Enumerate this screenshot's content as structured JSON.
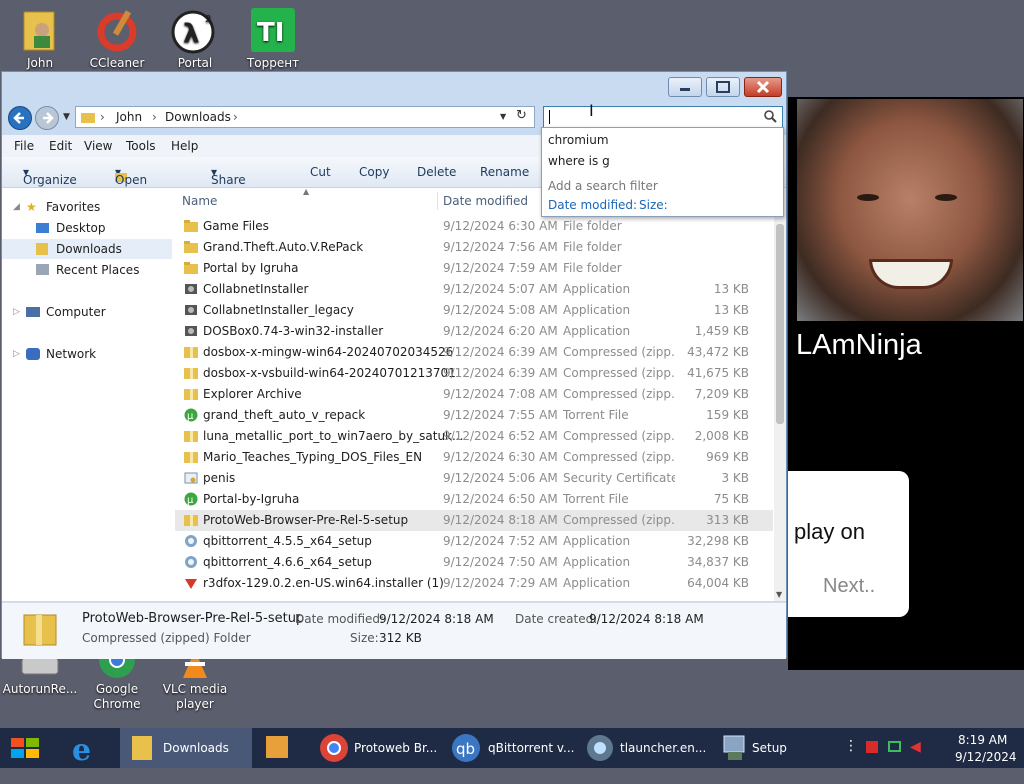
{
  "desktop": {
    "icons_top": [
      {
        "label": "John"
      },
      {
        "label": "CCleaner"
      },
      {
        "label": "Portal"
      },
      {
        "label": "Торрент"
      }
    ],
    "icons_bottom": [
      {
        "label": "AutorunRe..."
      },
      {
        "label": "Google Chrome"
      },
      {
        "label": "VLC media player"
      }
    ]
  },
  "video": {
    "streamer_name": "LAmNinja",
    "chat_text": "play on",
    "next_label": "Next.."
  },
  "window": {
    "address": {
      "crumbs": [
        "John",
        "Downloads"
      ]
    },
    "search": {
      "value": "",
      "suggestions": [
        "chromium",
        "where is g"
      ],
      "filter_hint": "Add a search filter",
      "filters": [
        "Date modified:",
        "Size:"
      ]
    },
    "menu": [
      "File",
      "Edit",
      "View",
      "Tools",
      "Help"
    ],
    "toolbar": [
      "Organize",
      "Open",
      "Share with",
      "Cut",
      "Copy",
      "Delete",
      "Rename"
    ],
    "navpane": {
      "favorites": "Favorites",
      "items": [
        "Desktop",
        "Downloads",
        "Recent Places"
      ],
      "computer": "Computer",
      "network": "Network"
    },
    "columns": {
      "name": "Name",
      "date": "Date modified"
    },
    "files": [
      {
        "name": "Game Files",
        "date": "9/12/2024 6:30 AM",
        "type": "File folder",
        "size": "",
        "icon": "folder"
      },
      {
        "name": "Grand.Theft.Auto.V.RePack",
        "date": "9/12/2024 7:56 AM",
        "type": "File folder",
        "size": "",
        "icon": "folder"
      },
      {
        "name": "Portal by Igruha",
        "date": "9/12/2024 7:59 AM",
        "type": "File folder",
        "size": "",
        "icon": "folder"
      },
      {
        "name": "CollabnetInstaller",
        "date": "9/12/2024 5:07 AM",
        "type": "Application",
        "size": "13 KB",
        "icon": "installer"
      },
      {
        "name": "CollabnetInstaller_legacy",
        "date": "9/12/2024 5:08 AM",
        "type": "Application",
        "size": "13 KB",
        "icon": "installer"
      },
      {
        "name": "DOSBox0.74-3-win32-installer",
        "date": "9/12/2024 6:20 AM",
        "type": "Application",
        "size": "1,459 KB",
        "icon": "installer"
      },
      {
        "name": "dosbox-x-mingw-win64-20240702034526",
        "date": "9/12/2024 6:39 AM",
        "type": "Compressed (zipp...",
        "size": "43,472 KB",
        "icon": "zip"
      },
      {
        "name": "dosbox-x-vsbuild-win64-20240701213701",
        "date": "9/12/2024 6:39 AM",
        "type": "Compressed (zipp...",
        "size": "41,675 KB",
        "icon": "zip"
      },
      {
        "name": "Explorer Archive",
        "date": "9/12/2024 7:08 AM",
        "type": "Compressed (zipp...",
        "size": "7,209 KB",
        "icon": "zip"
      },
      {
        "name": "grand_theft_auto_v_repack",
        "date": "9/12/2024 7:55 AM",
        "type": "Torrent File",
        "size": "159 KB",
        "icon": "torrent"
      },
      {
        "name": "luna_metallic_port_to_win7aero_by_satuk...",
        "date": "9/12/2024 6:52 AM",
        "type": "Compressed (zipp...",
        "size": "2,008 KB",
        "icon": "zip"
      },
      {
        "name": "Mario_Teaches_Typing_DOS_Files_EN",
        "date": "9/12/2024 6:30 AM",
        "type": "Compressed (zipp...",
        "size": "969 KB",
        "icon": "zip"
      },
      {
        "name": "penis",
        "date": "9/12/2024 5:06 AM",
        "type": "Security Certificate",
        "size": "3 KB",
        "icon": "cert"
      },
      {
        "name": "Portal-by-Igruha",
        "date": "9/12/2024 6:50 AM",
        "type": "Torrent File",
        "size": "75 KB",
        "icon": "torrent"
      },
      {
        "name": "ProtoWeb-Browser-Pre-Rel-5-setup",
        "date": "9/12/2024 8:18 AM",
        "type": "Compressed (zipp...",
        "size": "313 KB",
        "icon": "zip",
        "selected": true
      },
      {
        "name": "qbittorrent_4.5.5_x64_setup",
        "date": "9/12/2024 7:52 AM",
        "type": "Application",
        "size": "32,298 KB",
        "icon": "qbit"
      },
      {
        "name": "qbittorrent_4.6.6_x64_setup",
        "date": "9/12/2024 7:50 AM",
        "type": "Application",
        "size": "34,837 KB",
        "icon": "qbit"
      },
      {
        "name": "r3dfox-129.0.2.en-US.win64.installer (1)",
        "date": "9/12/2024 7:29 AM",
        "type": "Application",
        "size": "64,004 KB",
        "icon": "fox"
      }
    ],
    "details": {
      "name": "ProtoWeb-Browser-Pre-Rel-5-setup",
      "type": "Compressed (zipped) Folder",
      "date_modified_label": "Date modified:",
      "date_modified": "9/12/2024 8:18 AM",
      "date_created_label": "Date created:",
      "date_created": "9/12/2024 8:18 AM",
      "size_label": "Size:",
      "size": "312 KB"
    }
  },
  "taskbar": {
    "items": [
      "Downloads",
      "Protoweb Br...",
      "qBittorrent v...",
      "tlauncher.en...",
      "Setup"
    ],
    "time": "8:19 AM",
    "date": "9/12/2024"
  },
  "colors": {
    "taskbar": "#1f2a44",
    "desktop": "#5b5e6d",
    "window_frame": "#c8dbf0",
    "accent_link": "#1a66b8"
  }
}
